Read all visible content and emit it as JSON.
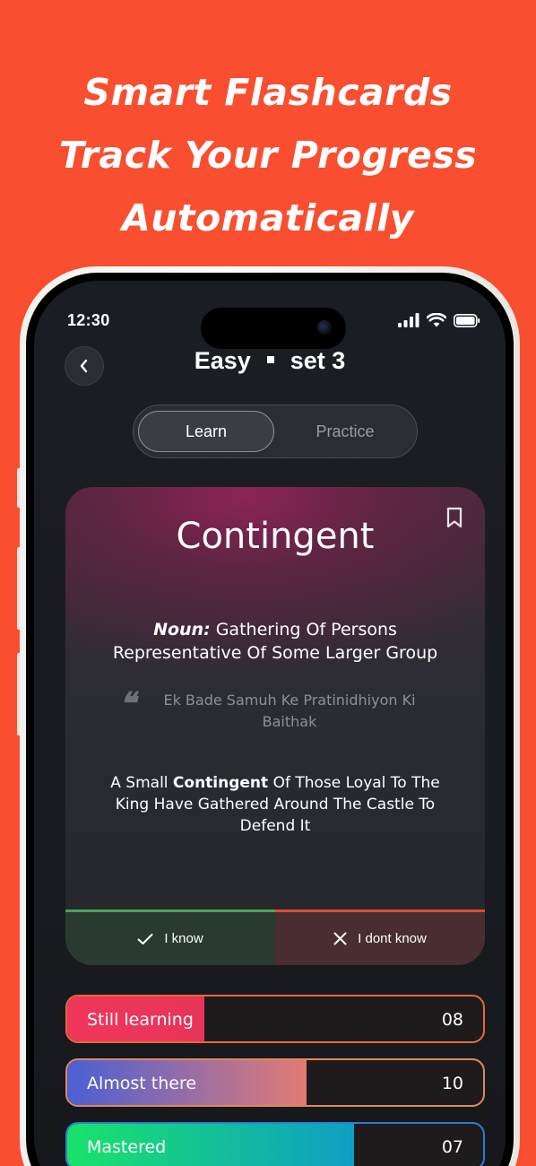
{
  "headline": {
    "line1": "Smart Flashcards",
    "line2": "Track Your Progress",
    "line3": "Automatically"
  },
  "status_bar": {
    "time": "12:30",
    "icons": [
      "signal-icon",
      "wifi-icon",
      "battery-icon"
    ]
  },
  "header": {
    "level": "Easy",
    "set": "set 3",
    "back_icon": "chevron-left-icon"
  },
  "mode_toggle": {
    "tabs": [
      {
        "label": "Learn",
        "selected": true
      },
      {
        "label": "Practice",
        "selected": false
      }
    ]
  },
  "card": {
    "word": "Contingent",
    "part_of_speech": "Noun:",
    "definition": " Gathering Of Persons Representative Of Some Larger Group",
    "hindi_meaning": "Ek Bade Samuh Ke Pratinidhiyon Ki Baithak",
    "example_before": "A Small ",
    "example_word": "Contingent",
    "example_after": " Of Those Loyal To The King Have Gathered Around The Castle To Defend It",
    "bookmark_icon": "bookmark-icon",
    "quote_icon": "quote-icon"
  },
  "answers": {
    "know_label": "I know",
    "dont_know_label": "I dont know",
    "know_color": "#4da25a",
    "dont_know_color": "#e04a3a"
  },
  "progress": [
    {
      "label": "Still learning",
      "count": "08",
      "fill_fraction": 0.33,
      "gradient": [
        "#f0365a",
        "#e8345a"
      ],
      "border": "#e46a3a"
    },
    {
      "label": "Almost there",
      "count": "10",
      "fill_fraction": 0.575,
      "gradient": [
        "#4a5fd6",
        "#e37b74"
      ],
      "border": "#e08a5a"
    },
    {
      "label": "Mastered",
      "count": "07",
      "fill_fraction": 0.69,
      "gradient": [
        "#19e36a",
        "#0f9ec4"
      ],
      "border": "#2b7fd6"
    }
  ],
  "colors": {
    "background": "#f94e2f"
  }
}
